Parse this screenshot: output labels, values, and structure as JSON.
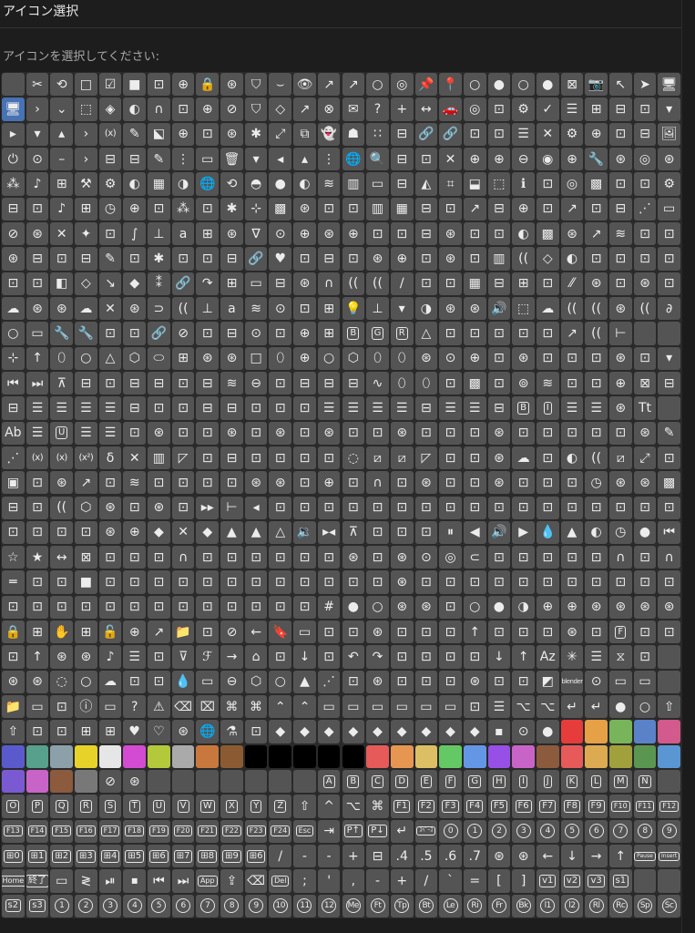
{
  "window": {
    "title": "アイコン選択"
  },
  "prompt": "アイコンを選択してください:",
  "icon_grid": {
    "rows": [
      [
        "",
        "✂",
        "⟲",
        "□",
        "☑",
        "■",
        "⊡",
        "⊕",
        "🔒",
        "⊛",
        "⛉",
        "⌣",
        "👁",
        "↗",
        "↗",
        "○",
        "◎",
        "📌",
        "📍",
        "○",
        "●",
        "○",
        "●",
        "⊠",
        "📷",
        "↖",
        "➤",
        "🖥"
      ],
      [
        "🖥",
        "›",
        "⌄",
        "⬚",
        "◈",
        "◐",
        "∩",
        "⊡",
        "⊕",
        "⊘",
        "⛉",
        "◇",
        "↗",
        "⊗",
        "✉",
        "?",
        "+",
        "↔",
        "🚗",
        "◎",
        "⊡",
        "⚙",
        "✓",
        "☰",
        "⊞",
        "⊟",
        "⊡",
        "▾"
      ],
      [
        "▸",
        "▾",
        "▴",
        "›",
        "(x)",
        "✎",
        "⬕",
        "⊕",
        "⊡",
        "⊛",
        "✱",
        "⤢",
        "⧉",
        "👻",
        "☗",
        "∷",
        "⊟",
        "🔗",
        "🔗",
        "⊡",
        "⊡",
        "☰",
        "✕",
        "⚙",
        "⊕",
        "⊡",
        "⊟",
        "🖼"
      ],
      [
        "⏻",
        "⊙",
        "–",
        "›",
        "⊟",
        "⊟",
        "✎",
        "⋮",
        "▭",
        "🗑",
        "▾",
        "◂",
        "▴",
        "⋮",
        "🌐",
        "🔍",
        "⊟",
        "⊡",
        "✕",
        "⊕",
        "⊕",
        "⊖",
        "◉",
        "⊕",
        "🔧",
        "⊛",
        "◎",
        "⊛"
      ],
      [
        "⁂",
        "♪",
        "⊞",
        "⚒",
        "⚙",
        "◐",
        "▦",
        "◑",
        "🌐",
        "⟲",
        "◓",
        "●",
        "◐",
        "≋",
        "▥",
        "▭",
        "⊟",
        "◭",
        "⌗",
        "⬓",
        "⬚",
        "ℹ",
        "⊡",
        "◎",
        "▩",
        "⊡",
        "⊡",
        "⚙"
      ],
      [
        "⊟",
        "⊡",
        "♪",
        "⊞",
        "◷",
        "⊕",
        "⊡",
        "⁂",
        "⊡",
        "✱",
        "⊹",
        "▩",
        "⊛",
        "⊡",
        "⊡",
        "▥",
        "▦",
        "⊟",
        "⊡",
        "↗",
        "⊟",
        "⊕",
        "⊡",
        "↗",
        "⊡",
        "⊟",
        "⋰",
        "▭"
      ],
      [
        "⊘",
        "⊛",
        "✕",
        "✦",
        "⊡",
        "∫",
        "⊥",
        "a",
        "⊞",
        "⊛",
        "∇",
        "⊙",
        "⊕",
        "⊛",
        "⊕",
        "⊡",
        "⊡",
        "⊟",
        "⊛",
        "⊡",
        "⊡",
        "◐",
        "▩",
        "⊛",
        "↗",
        "≋",
        "⊡",
        "⊡"
      ],
      [
        "⊛",
        "⊟",
        "⊡",
        "⊟",
        "✎",
        "⊡",
        "✱",
        "⊡",
        "⊡",
        "⊟",
        "🔗",
        "♥",
        "⊡",
        "⊟",
        "⊡",
        "⊛",
        "⊕",
        "⊡",
        "⊛",
        "⊡",
        "▥",
        "((",
        "◇",
        "◐",
        "⊡",
        "⊡",
        "⊡",
        "⊡"
      ],
      [
        "⊡",
        "⊡",
        "◧",
        "◇",
        "↘",
        "◆",
        "⁑",
        "🔗",
        "↷",
        "⊞",
        "▭",
        "⊟",
        "⊛",
        "∩",
        "((",
        "((",
        "∕",
        "⊡",
        "⊡",
        "▦",
        "⊟",
        "⊞",
        "⊡",
        "⁄⁄",
        "⊛",
        "⊡",
        "⊛",
        "⊡"
      ],
      [
        "☁",
        "⊛",
        "⊛",
        "☁",
        "✕",
        "⊛",
        "⊃",
        "((",
        "⊥",
        "a",
        "≋",
        "⊙",
        "⊡",
        "⊞",
        "💡",
        "⊥",
        "▾",
        "◑",
        "⊛",
        "⊛",
        "🔊",
        "⬚",
        "☁",
        "((",
        "((",
        "⊛",
        "((",
        "∂"
      ],
      [
        "○",
        "▭",
        "🔧",
        "🔧",
        "⊡",
        "⊡",
        "🔗",
        "⊘",
        "⊡",
        "⊟",
        "⊙",
        "⊡",
        "⊕",
        "⊞",
        "B",
        "G",
        "R",
        "△",
        "⊡",
        "⊡",
        "⊡",
        "⊡",
        "⊡",
        "↗",
        "((",
        "⊢"
      ],
      [
        "⊹",
        "↑",
        "⬯",
        "○",
        "△",
        "⬡",
        "⬭",
        "⊞",
        "⊛",
        "⊛",
        "□",
        "⬯",
        "⊕",
        "○",
        "⬡",
        "⬯",
        "⬯",
        "⊛",
        "⊙",
        "⊕",
        "⊡",
        "⊛",
        "⊡",
        "⊡",
        "⊡",
        "⊛",
        "⊡",
        "▾"
      ],
      [
        "⏮",
        "⏭",
        "⊼",
        "⊟",
        "⊡",
        "⊟",
        "⊟",
        "⊡",
        "⊟",
        "≋",
        "⊖",
        "⊡",
        "⊟",
        "⊟",
        "⊟",
        "∿",
        "⬯",
        "⬯",
        "⊡",
        "▩",
        "⊡",
        "⊚",
        "≋",
        "⊡",
        "⊡",
        "⊕",
        "⊠",
        "⊟"
      ],
      [
        "⊟",
        "☰",
        "☰",
        "☰",
        "☰",
        "⊟",
        "⊡",
        "⊡",
        "⊟",
        "⊟",
        "⊡",
        "⊡",
        "⊡",
        "☰",
        "☰",
        "☰",
        "☰",
        "⊟",
        "☰",
        "☰",
        "⊟",
        "B",
        "I",
        "☰",
        "☰",
        "⊛",
        "Tt"
      ],
      [
        "Ab",
        "☰",
        "U",
        "☰",
        "☰",
        "⊡",
        "⊛",
        "⊡",
        "⊡",
        "⊛",
        "⊡",
        "⊛",
        "⊡",
        "⊛",
        "⊡",
        "⊡",
        "⊛",
        "⊡",
        "⊡",
        "⊡",
        "⊛",
        "⊡",
        "⊡",
        "⊡",
        "⊡",
        "⊡",
        "⊛",
        "✎"
      ],
      [
        "⋰",
        "(x)",
        "(x)",
        "(x²)",
        "δ",
        "✕",
        "▥",
        "◸",
        "⊡",
        "⊟",
        "⊡",
        "⊡",
        "⊡",
        "⊡",
        "◌",
        "⧄",
        "⧄",
        "◸",
        "⊡",
        "⊡",
        "⊛",
        "☁",
        "⊡",
        "◐",
        "((",
        "⧄",
        "⤢",
        "⊡"
      ],
      [
        "▣",
        "⊡",
        "⊛",
        "↗",
        "⊡",
        "≋",
        "⊡",
        "⊡",
        "⊡",
        "⊡",
        "⊛",
        "⊛",
        "⊡",
        "⊕",
        "⊡",
        "∩",
        "⊡",
        "⊛",
        "⊡",
        "⊡",
        "⊛",
        "⊡",
        "⊡",
        "⊡",
        "◷",
        "⊛",
        "⊛",
        "▩"
      ],
      [
        "⊟",
        "⊡",
        "((",
        "⬡",
        "⊛",
        "⊡",
        "⊛",
        "⊡",
        "▸▸",
        "⊢",
        "◂",
        "⊡",
        "⊡",
        "⊡",
        "⊡",
        "⊡",
        "⊡",
        "⊡",
        "⊡",
        "⊡",
        "⊡",
        "⊡",
        "⊡",
        "⊡",
        "⊡",
        "⊡",
        "⊡",
        "⊡"
      ],
      [
        "⊡",
        "⊡",
        "⊡",
        "⊡",
        "⊛",
        "⊕",
        "◆",
        "✕",
        "◆",
        "▲",
        "▲",
        "△",
        "🔉",
        "▸◂",
        "⊼",
        "⊡",
        "⊡",
        "⊡",
        "⏸",
        "◀",
        "🔊",
        "▶",
        "💧",
        "▲",
        "◐",
        "◷",
        "●",
        "⏮"
      ],
      [
        "☆",
        "★",
        "↔",
        "⊠",
        "⊡",
        "⊡",
        "⊡",
        "∩",
        "⊡",
        "⊡",
        "⊡",
        "⊡",
        "⊡",
        "⊡",
        "⊛",
        "⊡",
        "⊛",
        "⊙",
        "◎",
        "⊂",
        "⊡",
        "⊡",
        "⊡",
        "⊡",
        "⊡",
        "∩",
        "⊡",
        "∩"
      ],
      [
        "═",
        "⊡",
        "⊡",
        "■",
        "⊡",
        "⊡",
        "⊡",
        "⊡",
        "⊡",
        "⊡",
        "⊡",
        "⊡",
        "⊡",
        "⊡",
        "⊡",
        "⊡",
        "⊛",
        "⊡",
        "⊡",
        "⊡",
        "⊡",
        "⊡",
        "⊡",
        "⊡",
        "⊡",
        "⊡",
        "⊡",
        "⊡"
      ],
      [
        "⊡",
        "⊡",
        "⊡",
        "⊡",
        "⊡",
        "⊡",
        "⊡",
        "⊡",
        "⊡",
        "⊡",
        "⊡",
        "⊡",
        "⊡",
        "#",
        "●",
        "○",
        "⊛",
        "⊛",
        "⊡",
        "○",
        "●",
        "◑",
        "⊕",
        "⊕",
        "⊛",
        "⊛",
        "⊛",
        "⊛"
      ],
      [
        "🔒",
        "⊞",
        "✋",
        "⊞",
        "🔓",
        "⊕",
        "↗",
        "📁",
        "⊡",
        "⊘",
        "←",
        "🔖",
        "▭",
        "⊡",
        "⊡",
        "⊛",
        "⊡",
        "⊡",
        "⊡",
        "↑",
        "⊡",
        "⊡",
        "⊡",
        "⊛",
        "⊡",
        "F",
        "⊡",
        "⊡"
      ],
      [
        "⊡",
        "↑",
        "⊛",
        "⊛",
        "♪",
        "☰",
        "⊡",
        "⊽",
        "ℱ",
        "→",
        "⌂",
        "⊡",
        "↓",
        "⊡",
        "↶",
        "↷",
        "⊡",
        "⊡",
        "⊡",
        "⊡",
        "↓",
        "↑",
        "Az",
        "✳",
        "☰",
        "⧖",
        "⊡"
      ],
      [
        "⊛",
        "⊛",
        "◌",
        "○",
        "☁",
        "⊡",
        "⊡",
        "💧",
        "▭",
        "⊖",
        "⬡",
        "○",
        "▲",
        "⋰",
        "⊡",
        "⊛",
        "⊡",
        "⊡",
        "⊡",
        "⊛",
        "⊡",
        "⊡",
        "◩",
        "blender",
        "⊙",
        "▭",
        "▭"
      ],
      [
        "📁",
        "▭",
        "⊡",
        "ⓘ",
        "▭",
        "?",
        "⚠",
        "⌫",
        "⌧",
        "⌘",
        "⌘",
        "⌃",
        "⌃",
        "▭",
        "▭",
        "▭",
        "▭",
        "▭",
        "▭",
        "⊡",
        "☰",
        "⌥",
        "⌥",
        "↵",
        "↵",
        "●",
        "○",
        "⇧"
      ],
      [
        "⇧",
        "⊡",
        "⊡",
        "⊞",
        "⊞",
        "♥",
        "♡",
        "⊛",
        "🌐",
        "⚗",
        "⊡",
        "◆",
        "◆",
        "◆",
        "◆",
        "◆",
        "◆",
        "◆",
        "◆",
        "◆",
        "▪",
        "⊙",
        "●",
        "",
        "",
        "",
        "",
        ""
      ],
      [
        "",
        "",
        "",
        "",
        "",
        "",
        "",
        "",
        "",
        "",
        "",
        "",
        "",
        "",
        "",
        "",
        "",
        "",
        "",
        "",
        "",
        "",
        "",
        "",
        "",
        "",
        "",
        ""
      ],
      [
        "",
        "",
        "",
        "",
        "⊘",
        "⊛",
        "",
        "",
        "",
        "",
        "",
        "",
        "",
        "A",
        "B",
        "C",
        "D",
        "E",
        "F",
        "G",
        "H",
        "I",
        "J",
        "K",
        "L",
        "M",
        "N"
      ],
      [
        "O",
        "P",
        "Q",
        "R",
        "S",
        "T",
        "U",
        "V",
        "W",
        "X",
        "Y",
        "Z",
        "⇧",
        "^",
        "⌥",
        "⌘",
        "F1",
        "F2",
        "F3",
        "F4",
        "F5",
        "F6",
        "F7",
        "F8",
        "F9",
        "F10",
        "F11",
        "F12"
      ],
      [
        "F13",
        "F14",
        "F15",
        "F16",
        "F17",
        "F18",
        "F19",
        "F20",
        "F21",
        "F22",
        "F23",
        "F24",
        "Esc",
        "⇥",
        "P↑",
        "P↓",
        "↵",
        "ｽﾍﾟｰｽ",
        "0",
        "1",
        "2",
        "3",
        "4",
        "5",
        "6",
        "7",
        "8",
        "9"
      ],
      [
        "⊞0",
        "⊞1",
        "⊞2",
        "⊞3",
        "⊞4",
        "⊞5",
        "⊞6",
        "⊞7",
        "⊞8",
        "⊞9",
        "⊞6",
        "/",
        "-",
        "-",
        "+",
        "⊟",
        ".4",
        ".5",
        ".6",
        ".7",
        "⊛",
        "⊛",
        "←",
        "↓",
        "→",
        "↑",
        "Pause",
        "Insert"
      ],
      [
        "Home",
        "終了",
        "▭",
        "≷",
        "⏯",
        "⏹",
        "⏮",
        "⏭",
        "App",
        "⇪",
        "⌫",
        "Del",
        ";",
        "'",
        ",",
        "-",
        "+",
        "/",
        "`",
        "=",
        "[",
        "]",
        "v1",
        "v2",
        "v3",
        "s1"
      ],
      [
        "s2",
        "s3",
        "1",
        "2",
        "3",
        "4",
        "5",
        "6",
        "7",
        "8",
        "9",
        "10",
        "11",
        "12",
        "Me",
        "Ft",
        "Tp",
        "Bt",
        "Le",
        "Ri",
        "Fr",
        "Bk",
        "l1",
        "l2",
        "Rl",
        "Rc",
        "Sp",
        "Sc"
      ]
    ],
    "color_cells": {
      "26": [
        "#e63c3c",
        "#e6a046",
        "#78b45a",
        "#5a82c8",
        "#d25a8c"
      ],
      "27": [
        "#5a5acd",
        "#56a08c",
        "#8ca0aa",
        "#e6d228",
        "#e6e6e6",
        "#d24bd2",
        "#b4c83c",
        "#aaaaaa",
        "#c8783c",
        "#8c5a32",
        "#000000",
        "#000000",
        "#000000",
        "#000000",
        "#000000",
        "#e65a5a",
        "#e69650",
        "#dcbe64",
        "#64c864",
        "#6496e6",
        "#9650e6",
        "#c864c8",
        "#8c5a3c",
        "#e65a5a",
        "#dcaa50",
        "#a0a03c",
        "#5a9650",
        "#5a96d2"
      ],
      "28": [
        "#7a5ad2",
        "#c864c8",
        "#8c5a3c",
        "#787878"
      ]
    },
    "selected": [
      1,
      0
    ]
  },
  "colors": {
    "background": "#1d1d1d",
    "panel": "#2a2a2a",
    "cell": "#545454",
    "cell_selected": "#4772b3",
    "icon": "#ececec",
    "text_muted": "#a8a8a8"
  }
}
